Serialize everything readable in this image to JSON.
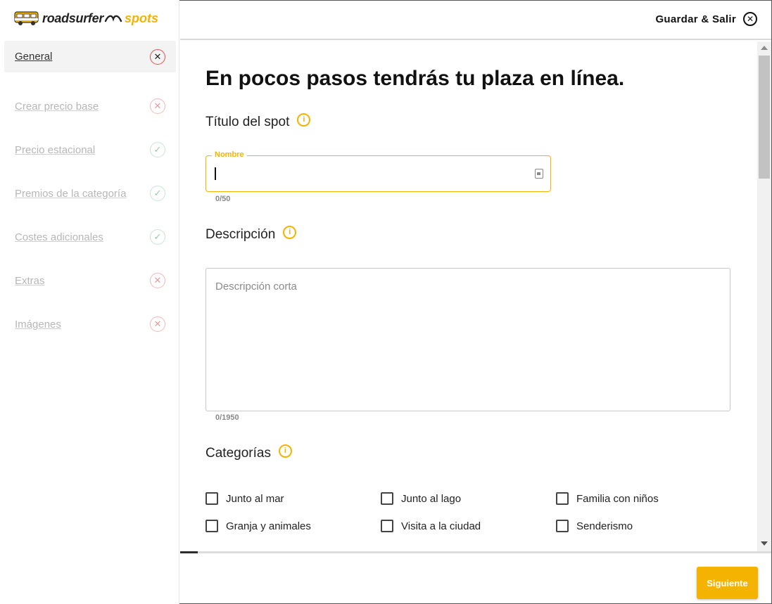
{
  "brand": {
    "word": "roadsurfer",
    "product": "spots",
    "accent": "#f5b301"
  },
  "header": {
    "save_exit_label": "Guardar & Salir"
  },
  "sidebar": {
    "items": [
      {
        "label": "General",
        "status": "incomplete",
        "active": true
      },
      {
        "label": "Crear precio base",
        "status": "incomplete",
        "active": false
      },
      {
        "label": "Precio estacional",
        "status": "complete",
        "active": false
      },
      {
        "label": "Premios de la categoría",
        "status": "complete",
        "active": false
      },
      {
        "label": "Costes adicionales",
        "status": "complete",
        "active": false
      },
      {
        "label": "Extras",
        "status": "incomplete",
        "active": false
      },
      {
        "label": "Imágenes",
        "status": "incomplete",
        "active": false
      }
    ]
  },
  "main": {
    "heading": "En pocos pasos tendrás tu plaza en línea.",
    "title_section": {
      "label": "Título del spot",
      "field_legend": "Nombre",
      "value": "",
      "counter": "0/50"
    },
    "description_section": {
      "label": "Descripción",
      "placeholder": "Descripción corta",
      "counter": "0/1950"
    },
    "categories_section": {
      "label": "Categorías",
      "options": [
        {
          "label": "Junto al mar",
          "checked": false
        },
        {
          "label": "Junto al lago",
          "checked": false
        },
        {
          "label": "Familia con niños",
          "checked": false
        },
        {
          "label": "Granja y animales",
          "checked": false
        },
        {
          "label": "Visita a la ciudad",
          "checked": false
        },
        {
          "label": "Senderismo",
          "checked": false
        }
      ]
    }
  },
  "footer": {
    "next_label": "Siguiente",
    "progress": 0.03
  }
}
